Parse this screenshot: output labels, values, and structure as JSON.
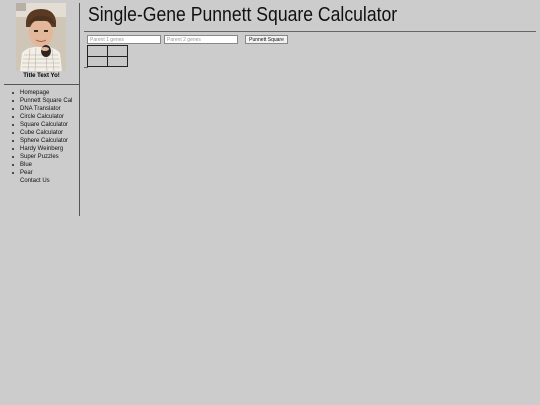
{
  "page": {
    "title": "Single-Gene Punnett Square Calculator"
  },
  "sidebar": {
    "site_title": "Title Text Yo!",
    "nav_items": [
      {
        "label": "Homepage",
        "bullet": true
      },
      {
        "label": "Punnett Square Cal",
        "bullet": true
      },
      {
        "label": "DNA Translator",
        "bullet": true
      },
      {
        "label": "Circle Calculator",
        "bullet": true
      },
      {
        "label": "Square Calculator",
        "bullet": true
      },
      {
        "label": "Cube Calculator",
        "bullet": true
      },
      {
        "label": "Sphere Calculator",
        "bullet": true
      },
      {
        "label": "Hardy Weinberg",
        "bullet": true
      },
      {
        "label": "Super Puzzles",
        "bullet": true
      },
      {
        "label": "Blue",
        "bullet": true
      },
      {
        "label": "Pear",
        "bullet": true
      },
      {
        "label": "Contact Us",
        "bullet": false
      }
    ]
  },
  "form": {
    "parent1_placeholder": "Parent 1 genes",
    "parent2_placeholder": "Parent 2 genes",
    "parent1_value": "",
    "parent2_value": "",
    "submit_label": "Punnett Square"
  },
  "colors": {
    "background": "#cccccc",
    "divider": "#555555"
  }
}
